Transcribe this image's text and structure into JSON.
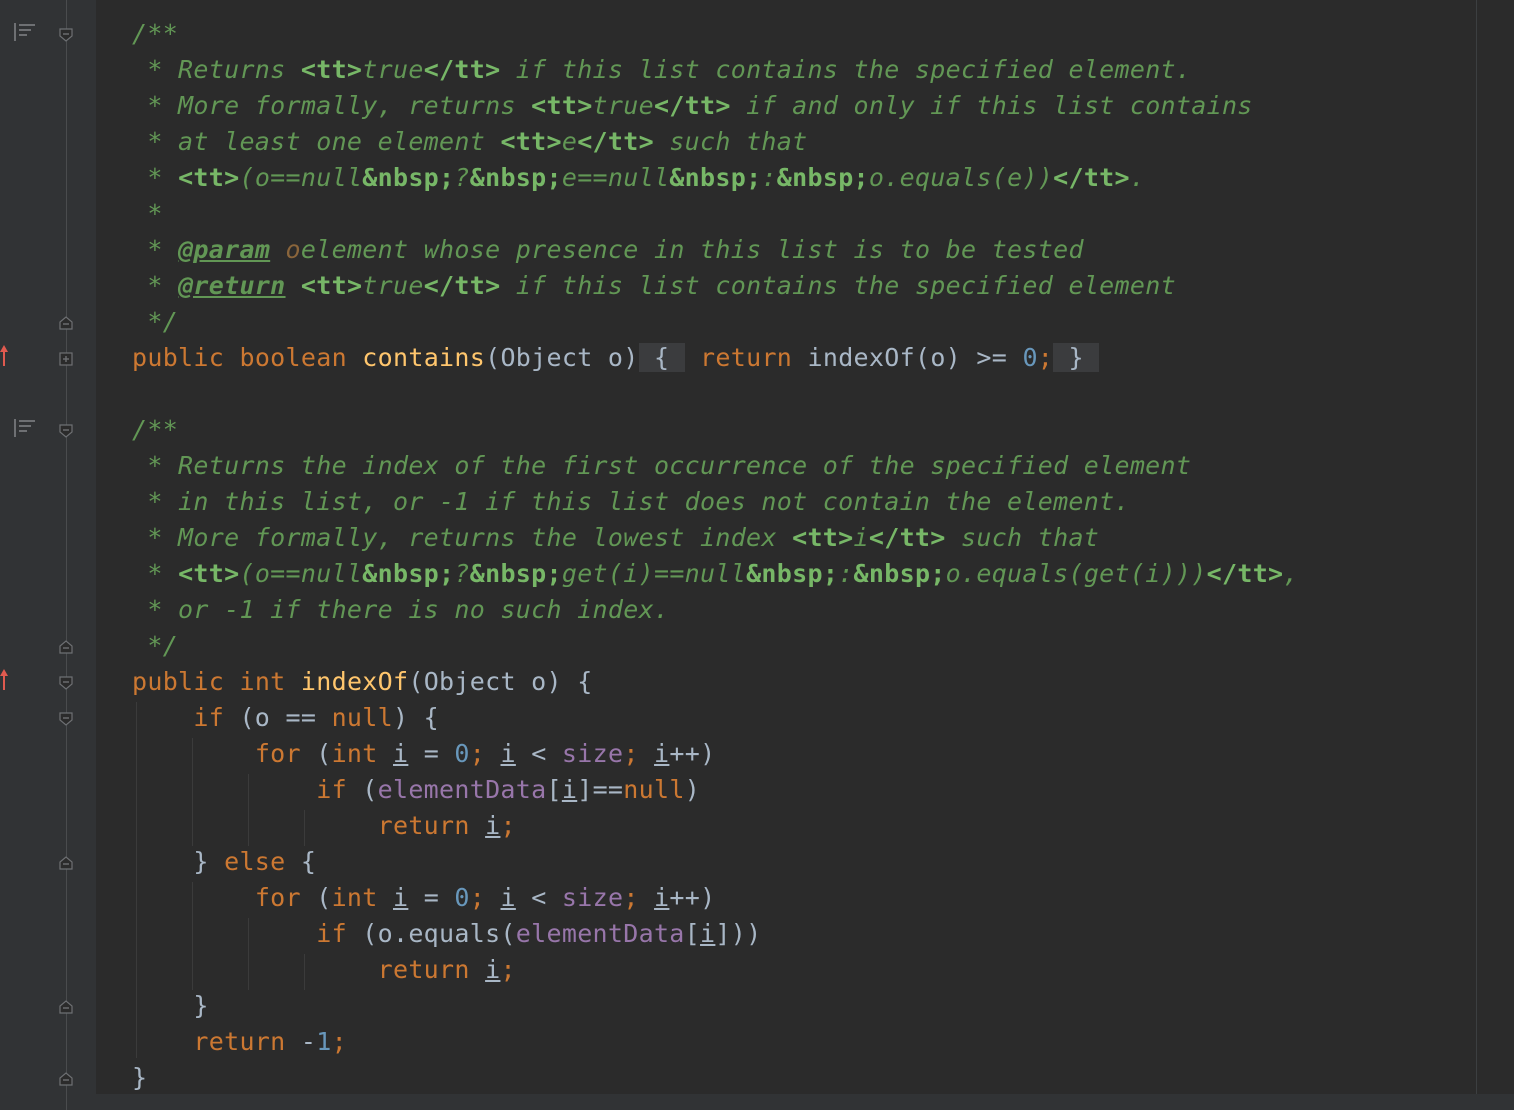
{
  "editor": {
    "language": "Java",
    "colors": {
      "background": "#2b2b2b",
      "gutter": "#313335",
      "comment": "#629755",
      "keyword": "#cc7832",
      "number": "#6897bb",
      "method_decl": "#ffc66d",
      "field": "#9876aa",
      "default_text": "#a9b7c6",
      "override_arrow": "#e05a4f"
    },
    "icons": {
      "doc_render": "rendered-doc-icon",
      "fold_open": "fold-collapse-icon",
      "fold_end": "fold-end-icon",
      "fold_closed": "fold-expand-icon",
      "override": "overrides-method-arrow-icon"
    },
    "lines": [
      "/**",
      " * Returns <tt>true</tt> if this list contains the specified element.",
      " * More formally, returns <tt>true</tt> if and only if this list contains",
      " * at least one element <tt>e</tt> such that",
      " * <tt>(o==null&nbsp;?&nbsp;e==null&nbsp;:&nbsp;o.equals(e))</tt>.",
      " *",
      " * @param o element whose presence in this list is to be tested",
      " * @return <tt>true</tt> if this list contains the specified element",
      " */",
      "public boolean contains(Object o) { return indexOf(o) >= 0; }",
      "",
      "/**",
      " * Returns the index of the first occurrence of the specified element",
      " * in this list, or -1 if this list does not contain the element.",
      " * More formally, returns the lowest index <tt>i</tt> such that",
      " * <tt>(o==null&nbsp;?&nbsp;get(i)==null&nbsp;:&nbsp;o.equals(get(i)))</tt>,",
      " * or -1 if there is no such index.",
      " */",
      "public int indexOf(Object o) {",
      "    if (o == null) {",
      "        for (int i = 0; i < size; i++)",
      "            if (elementData[i]==null)",
      "                return i;",
      "    } else {",
      "        for (int i = 0; i < size; i++)",
      "            if (o.equals(elementData[i]))",
      "                return i;",
      "    }",
      "    return -1;",
      "}"
    ]
  }
}
